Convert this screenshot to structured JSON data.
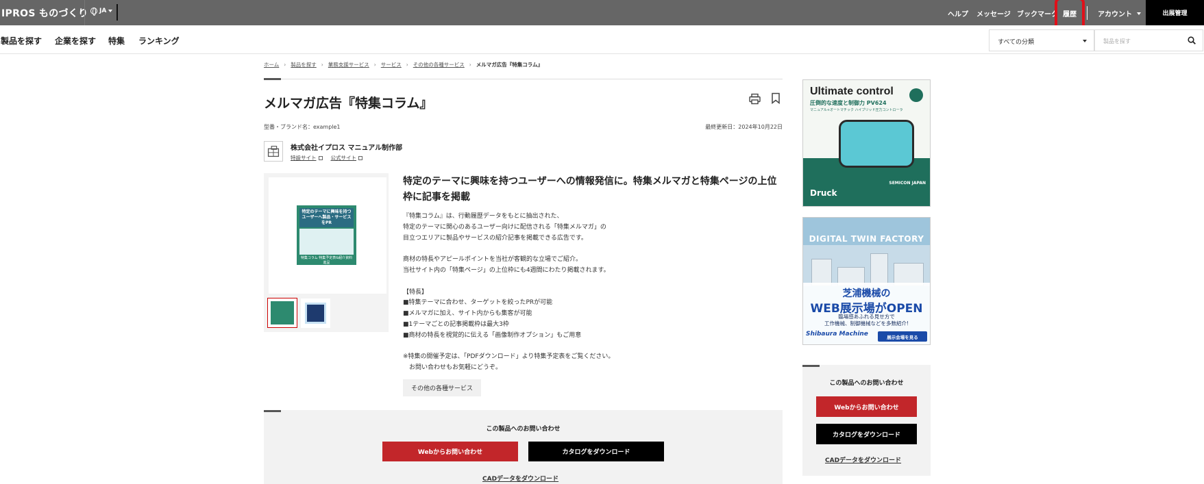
{
  "header": {
    "logo_text": "IPROS ものづくり",
    "language": "JA",
    "nav": [
      "ヘルプ",
      "メッセージ",
      "ブックマーク",
      "履歴",
      "アカウント"
    ],
    "publish_button": "出展管理"
  },
  "subnav": {
    "items": [
      "製品を探す",
      "企業を探す",
      "特集",
      "ランキング"
    ],
    "category_select": "すべての分類",
    "search_placeholder": "製品を探す"
  },
  "breadcrumb": {
    "links": [
      "ホーム",
      "製品を探す",
      "業務支援サービス",
      "サービス",
      "その他の各種サービス"
    ],
    "current": "メルマガ広告『特集コラム』"
  },
  "product": {
    "title": "メルマガ広告『特集コラム』",
    "model_line": "型番・ブランド名：example1",
    "updated_line": "最終更新日：2024年10月22日",
    "company_name": "株式会社イプロス マニュアル制作部",
    "company_links": [
      "特設サイト",
      "公式サイト"
    ],
    "image_text_top": "特定のテーマに興味を持つユーザーへ製品・サービスをPR",
    "image_text_bottom": "特集コラム 特集予定表&紹介資料 進呈",
    "lead": "特定のテーマに興味を持つユーザーへの情報発信に。特集メルマガと特集ページの上位枠に記事を掲載",
    "description": "『特集コラム』は、行動履歴データをもとに抽出された、\n特定のテーマに関心のあるユーザー向けに配信される「特集メルマガ」の\n目立つエリアに製品やサービスの紹介記事を掲載できる広告です。\n\n商材の特長やアピールポイントを当社が客観的な立場でご紹介。\n当社サイト内の「特集ページ」の上位枠にも4週間にわたり掲載されます。\n\n【特長】\n■特集テーマに合わせ、ターゲットを絞ったPRが可能\n■メルマガに加え、サイト内からも集客が可能\n■1テーマごとの記事掲載枠は最大3枠\n■商材の特長を視覚的に伝える「画像制作オプション」もご用意\n\n※特集の開催予定は、「PDFダウンロード」より特集予定表をご覧ください。\n　お問い合わせもお気軽にどうぞ。",
    "category_tag": "その他の各種サービス"
  },
  "contact": {
    "title": "この製品へのお問い合わせ",
    "web_button": "Webからお問い合わせ",
    "catalog_button": "カタログをダウンロード",
    "cad_link": "CADデータをダウンロード"
  },
  "ads": {
    "ad1": {
      "headline": "Ultimate control",
      "sub": "圧倒的な速度と制御力 PV624",
      "sub2": "マニュアル+オートマチック ハイブリッド圧力コントローラ",
      "brand": "Druck",
      "event": "SEMICON JAPAN"
    },
    "ad2": {
      "headline": "DIGITAL TWIN FACTORY",
      "line1": "芝浦機械の",
      "line2": "WEB展示場がOPEN",
      "line3": "臨場感あふれる見せ方で\n工作機械、制御機械などを多数紹介!",
      "brand": "Shibaura Machine",
      "cta": "展示会場を見る"
    }
  },
  "colors": {
    "topbar": "#666666",
    "red_button": "#c2262a",
    "highlight_box": "#e0101a"
  }
}
